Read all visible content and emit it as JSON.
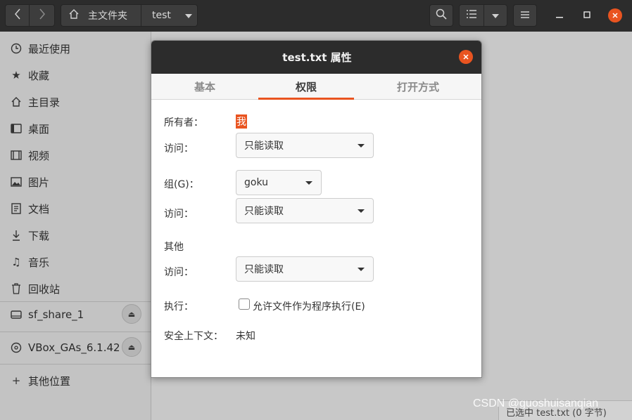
{
  "window": {
    "path_home": "主文件夹",
    "path_current": "test"
  },
  "sidebar": {
    "items": [
      {
        "label": "最近使用",
        "icon": "clock-icon"
      },
      {
        "label": "收藏",
        "icon": "star-icon"
      },
      {
        "label": "主目录",
        "icon": "home-icon"
      },
      {
        "label": "桌面",
        "icon": "desktop-icon"
      },
      {
        "label": "视频",
        "icon": "film-icon"
      },
      {
        "label": "图片",
        "icon": "image-icon"
      },
      {
        "label": "文档",
        "icon": "document-icon"
      },
      {
        "label": "下载",
        "icon": "download-icon"
      },
      {
        "label": "音乐",
        "icon": "music-icon"
      },
      {
        "label": "回收站",
        "icon": "trash-icon"
      }
    ],
    "devices": [
      {
        "label": "sf_share_1",
        "icon": "drive-icon"
      },
      {
        "label": "VBox_GAs_6.1.42",
        "icon": "disc-icon"
      }
    ],
    "other_locations": "其他位置"
  },
  "statusbar": {
    "text": "已选中 test.txt (0 字节)"
  },
  "watermark": "CSDN @guoshuisanqian",
  "dialog": {
    "title": "test.txt 属性",
    "tabs": [
      "基本",
      "权限",
      "打开方式"
    ],
    "active_tab": "权限",
    "owner_label": "所有者：",
    "owner_value": "我",
    "owner_access_label": "访问：",
    "owner_access_value": "只能读取",
    "group_label": "组(G)：",
    "group_value": "goku",
    "group_access_label": "访问：",
    "group_access_value": "只能读取",
    "others_label": "其他",
    "others_access_label": "访问：",
    "others_access_value": "只能读取",
    "execute_label": "执行：",
    "execute_checkbox_label": "允许文件作为程序执行(E)",
    "execute_checked": false,
    "security_context_label": "安全上下文：",
    "security_context_value": "未知"
  },
  "colors": {
    "accent": "#e95420",
    "headerbar": "#2c2c2c"
  }
}
